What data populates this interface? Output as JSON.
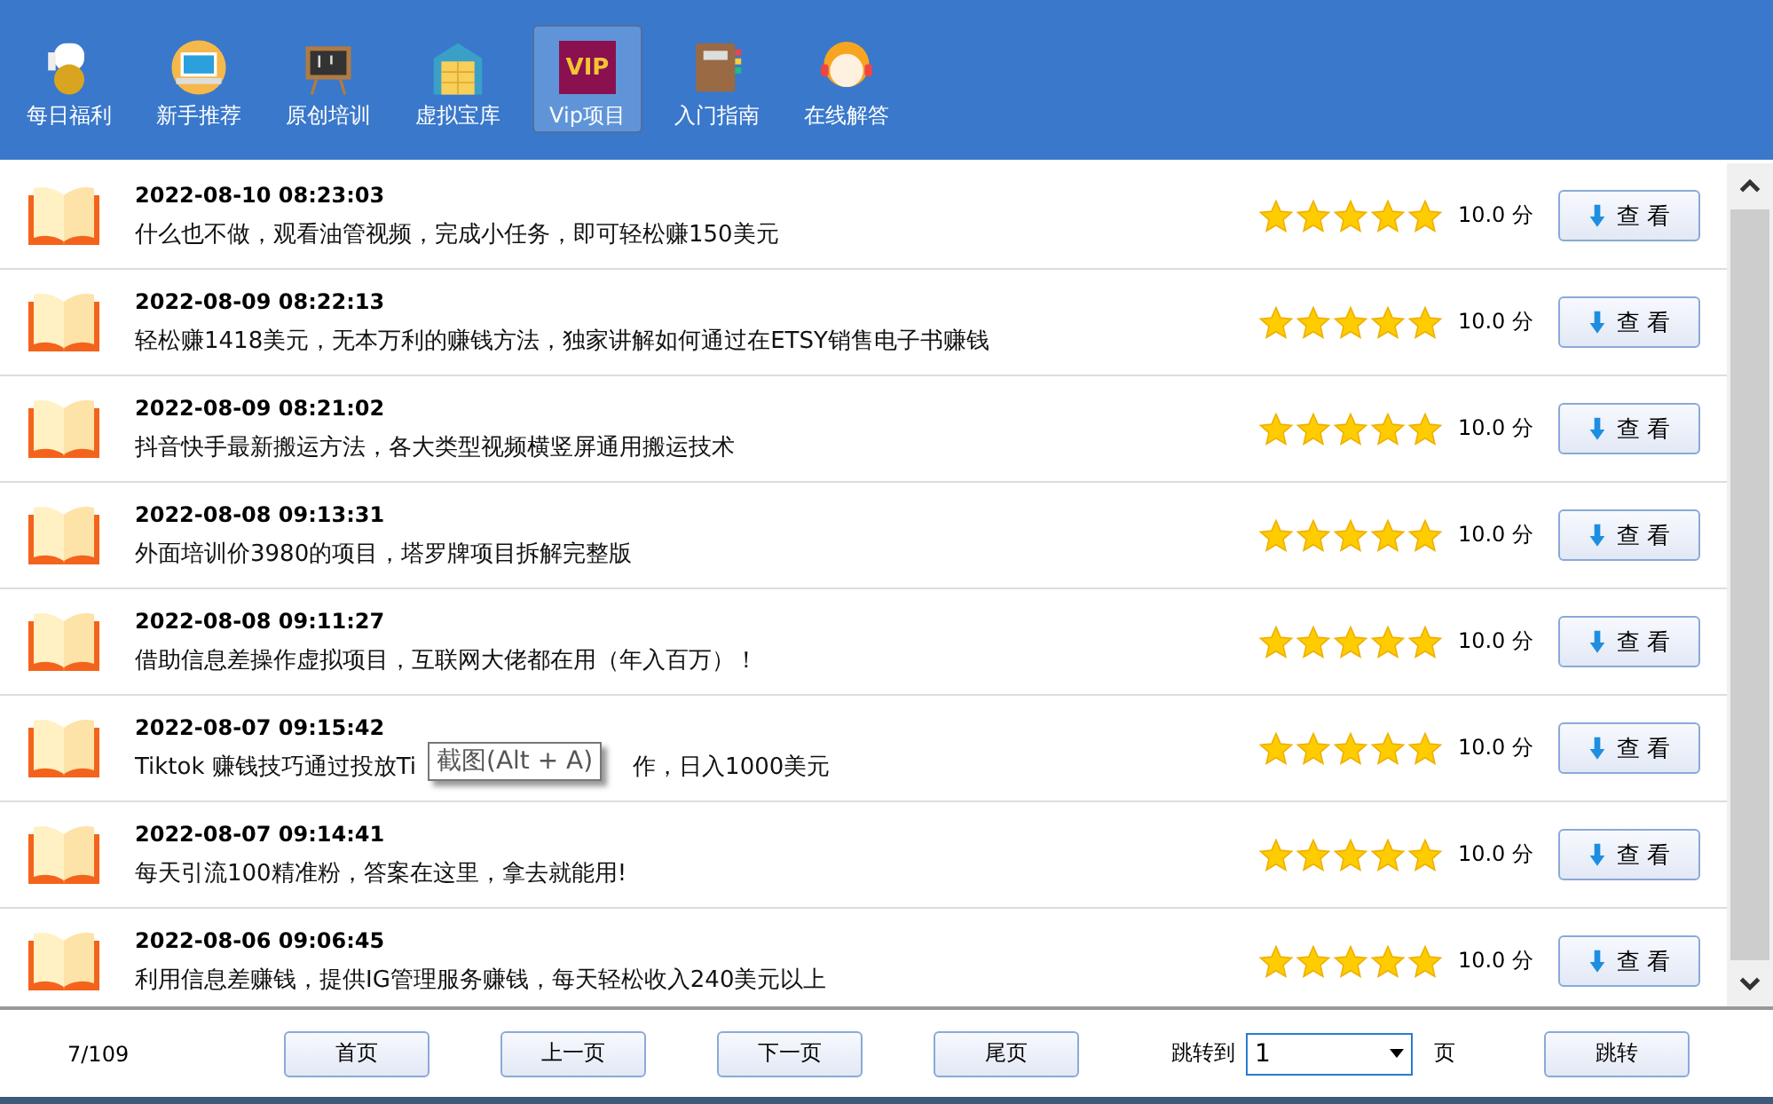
{
  "nav": [
    {
      "label": "每日福利",
      "selected": false
    },
    {
      "label": "新手推荐",
      "selected": false
    },
    {
      "label": "原创培训",
      "selected": false
    },
    {
      "label": "虚拟宝库",
      "selected": false
    },
    {
      "label": "Vip项目",
      "selected": true,
      "badge": "VIP"
    },
    {
      "label": "入门指南",
      "selected": false
    },
    {
      "label": "在线解答",
      "selected": false
    }
  ],
  "rows": [
    {
      "date": "2022-08-10 08:23:03",
      "title": "什么也不做，观看油管视频，完成小任务，即可轻松赚150美元",
      "stars": 5,
      "score": "10.0 分",
      "button": "查 看"
    },
    {
      "date": "2022-08-09 08:22:13",
      "title": "轻松赚1418美元，无本万利的赚钱方法，独家讲解如何通过在ETSY销售电子书赚钱",
      "stars": 5,
      "score": "10.0 分",
      "button": "查 看"
    },
    {
      "date": "2022-08-09 08:21:02",
      "title": "抖音快手最新搬运方法，各大类型视频横竖屏通用搬运技术",
      "stars": 5,
      "score": "10.0 分",
      "button": "查 看"
    },
    {
      "date": "2022-08-08 09:13:31",
      "title": "外面培训价3980的项目，塔罗牌项目拆解完整版",
      "stars": 5,
      "score": "10.0 分",
      "button": "查 看"
    },
    {
      "date": "2022-08-08 09:11:27",
      "title": "借助信息差操作虚拟项目，互联网大佬都在用（年入百万）！",
      "stars": 5,
      "score": "10.0 分",
      "button": "查 看"
    },
    {
      "date": "2022-08-07 09:15:42",
      "title": "Tiktok 赚钱技巧通过投放Ti",
      "title_tail": "作，日入1000美元",
      "tooltip": "截图(Alt + A)",
      "stars": 5,
      "score": "10.0 分",
      "button": "查 看"
    },
    {
      "date": "2022-08-07 09:14:41",
      "title": "每天引流100精准粉，答案在这里，拿去就能用!",
      "stars": 5,
      "score": "10.0 分",
      "button": "查 看"
    },
    {
      "date": "2022-08-06 09:06:45",
      "title": "利用信息差赚钱，提供IG管理服务赚钱，每天轻松收入240美元以上",
      "stars": 5,
      "score": "10.0 分",
      "button": "查 看"
    }
  ],
  "footer": {
    "page": "7/109",
    "buttons": [
      "首页",
      "上一页",
      "下一页",
      "尾页"
    ],
    "jump_label": "跳转到",
    "jump_value": "1",
    "unit": "页",
    "go_button": "跳转"
  }
}
